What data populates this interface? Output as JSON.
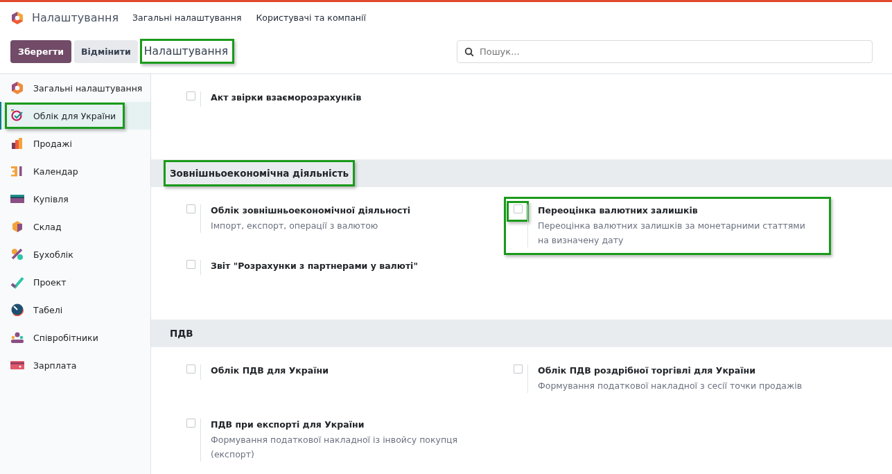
{
  "app": {
    "title": "Налаштування",
    "menu": [
      {
        "label": "Загальні налаштування"
      },
      {
        "label": "Користувачі та компанії"
      }
    ]
  },
  "toolbar": {
    "save": "Зберегти",
    "discard": "Відмінити",
    "breadcrumb": "Налаштування",
    "breadcrumb_highlighted": true,
    "search": {
      "placeholder": "Пошук..."
    }
  },
  "sidebar": {
    "items": [
      {
        "label": "Загальні налаштування",
        "selected": false,
        "highlighted": false
      },
      {
        "label": "Облік для України",
        "selected": true,
        "highlighted": true
      },
      {
        "label": "Продажі",
        "selected": false,
        "highlighted": false
      },
      {
        "label": "Календар",
        "selected": false,
        "highlighted": false
      },
      {
        "label": "Купівля",
        "selected": false,
        "highlighted": false
      },
      {
        "label": "Склад",
        "selected": false,
        "highlighted": false
      },
      {
        "label": "Бухоблік",
        "selected": false,
        "highlighted": false
      },
      {
        "label": "Проект",
        "selected": false,
        "highlighted": false
      },
      {
        "label": "Табелі",
        "selected": false,
        "highlighted": false
      },
      {
        "label": "Співробітники",
        "selected": false,
        "highlighted": false
      },
      {
        "label": "Зарплата",
        "selected": false,
        "highlighted": false
      }
    ]
  },
  "sections": [
    {
      "settings": [
        {
          "title": "Акт звірки взаєморозрахунків",
          "checked": false,
          "highlighted": false
        }
      ]
    },
    {
      "title": "Зовнішньоекономічна діяльність",
      "highlighted": true,
      "settings": [
        {
          "title": "Облік зовнішньоекономічної діяльності",
          "description": "Імпорт, експорт, операції з валютою",
          "checked": false,
          "highlighted": false
        },
        {
          "title": "Переоцінка валютних залишків",
          "description": "Переоцінка валютних залишків за монетарними статтями на визначену дату",
          "checked": false,
          "highlighted": true
        },
        {
          "title": "Звіт \"Розрахунки з партнерами у валюті\"",
          "checked": false,
          "highlighted": false
        }
      ]
    },
    {
      "title": "ПДВ",
      "highlighted": false,
      "settings": [
        {
          "title": "Облік ПДВ для України",
          "checked": false,
          "highlighted": false
        },
        {
          "title": "Облік ПДВ роздрібної торгівлі для України",
          "description": "Формування податкової накладної з сесії точки продажів",
          "checked": false,
          "highlighted": false
        },
        {
          "title": "ПДВ при експорті для України",
          "description": "Формування податкової накладної із інвойсу покупця (експорт)",
          "checked": false,
          "highlighted": false
        }
      ]
    }
  ]
}
